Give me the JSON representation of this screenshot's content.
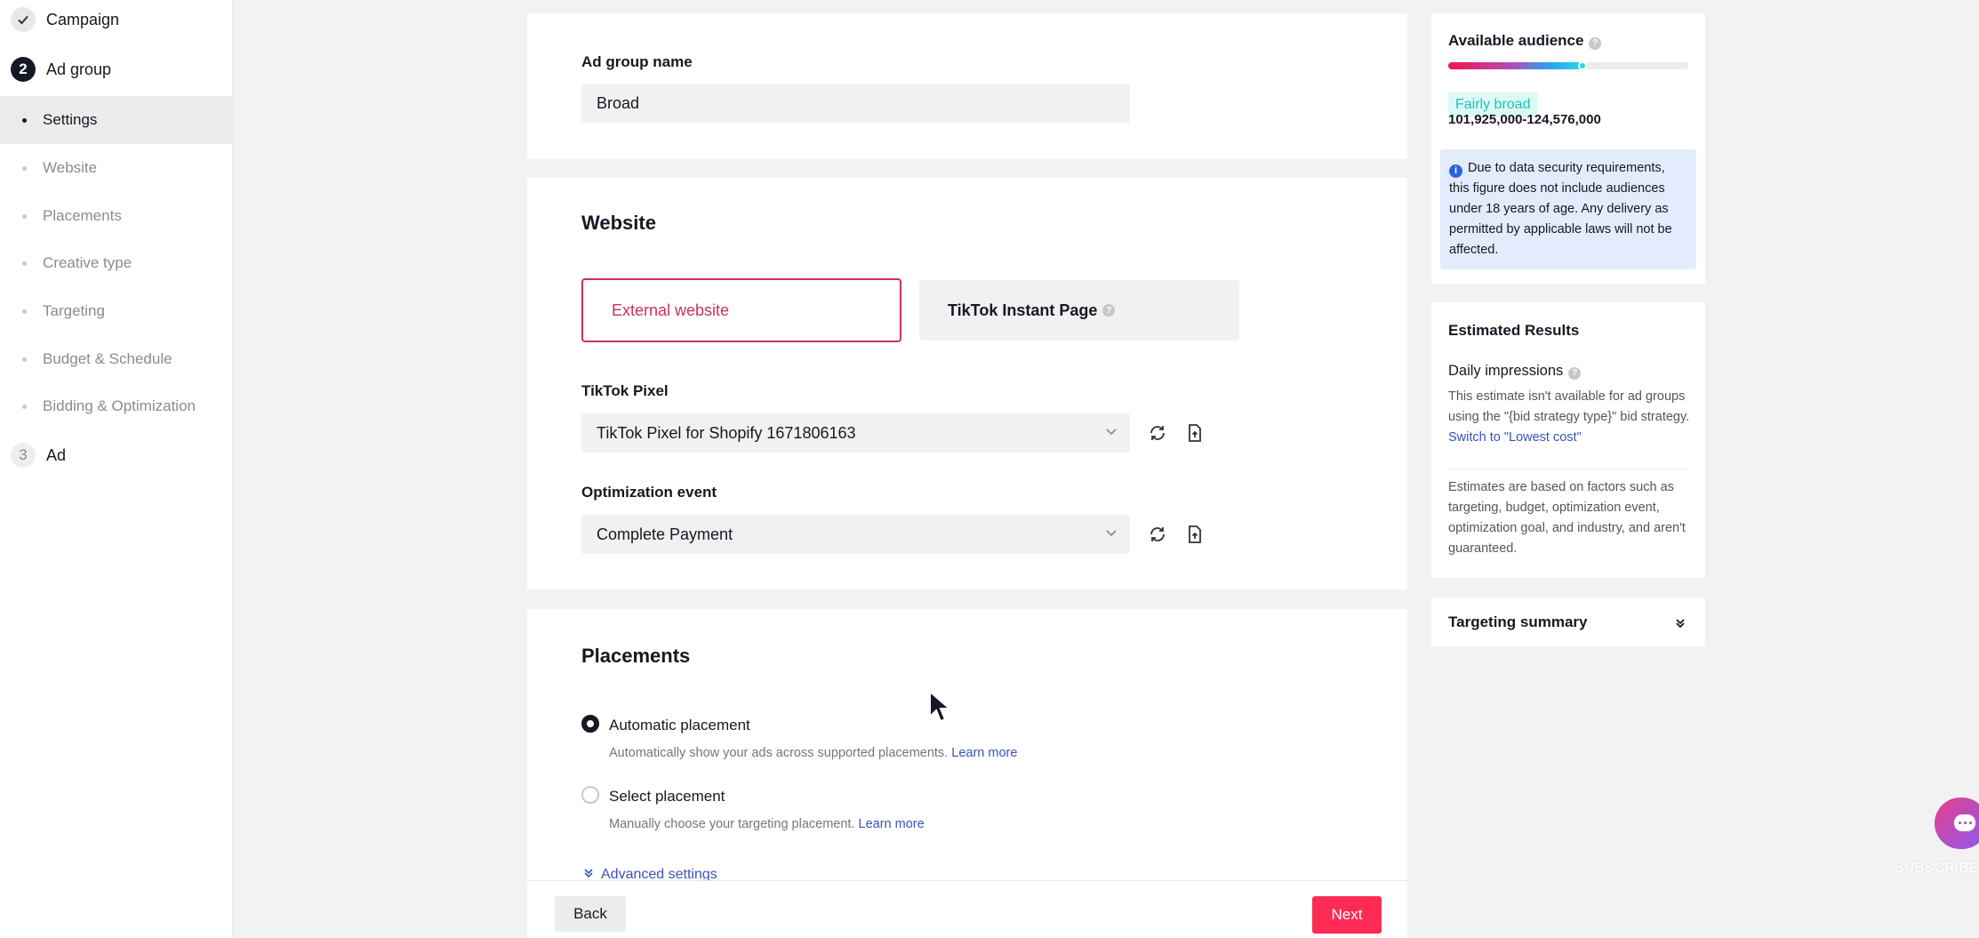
{
  "sidebar": {
    "steps": [
      {
        "num": "✓",
        "label": "Campaign"
      },
      {
        "num": "2",
        "label": "Ad group"
      },
      {
        "num": "3",
        "label": "Ad"
      }
    ],
    "substeps": [
      {
        "label": "Settings"
      },
      {
        "label": "Website"
      },
      {
        "label": "Placements"
      },
      {
        "label": "Creative type"
      },
      {
        "label": "Targeting"
      },
      {
        "label": "Budget & Schedule"
      },
      {
        "label": "Bidding & Optimization"
      }
    ]
  },
  "adgroup": {
    "name_label": "Ad group name",
    "name_value": "Broad"
  },
  "website": {
    "title": "Website",
    "option_external": "External website",
    "option_instant": "TikTok Instant Page",
    "pixel_label": "TikTok Pixel",
    "pixel_value": "TikTok Pixel for Shopify 1671806163",
    "event_label": "Optimization event",
    "event_value": "Complete Payment"
  },
  "placements": {
    "title": "Placements",
    "auto_label": "Automatic placement",
    "auto_desc": "Automatically show your ads across supported placements.",
    "auto_link": "Learn more",
    "select_label": "Select placement",
    "select_desc": "Manually choose your targeting placement.",
    "select_link": "Learn more",
    "advanced": "Advanced settings"
  },
  "footer": {
    "back": "Back",
    "next": "Next"
  },
  "audience": {
    "title": "Available audience",
    "level": 0.56,
    "badge": "Fairly broad",
    "range": "101,925,000-124,576,000",
    "info": "Due to data security requirements, this figure does not include audiences under 18 years of age. Any delivery as permitted by applicable laws will not be affected."
  },
  "estimated": {
    "title": "Estimated Results",
    "impressions_label": "Daily impressions",
    "note": "This estimate isn't available for ad groups using the \"{bid strategy type}\" bid strategy.",
    "note_link": "Switch to \"Lowest cost\"",
    "disclaimer": "Estimates are based on factors such as targeting, budget, optimization event, optimization goal, and industry, and aren't guaranteed."
  },
  "targeting_summary": {
    "title": "Targeting summary"
  },
  "watermark": "SUBSCRIBE",
  "colors": {
    "brand": "#fe2c55",
    "selected_border": "#c9325a",
    "link": "#3a53b8",
    "badge_bg": "#ddf9f6",
    "info_bg": "#e3ecfc"
  },
  "icons": [
    "check-icon",
    "refresh-icon",
    "file-upload-icon",
    "chevron-down-icon",
    "help-icon",
    "info-icon",
    "double-chevron-down-icon",
    "chat-icon",
    "cursor-icon"
  ]
}
